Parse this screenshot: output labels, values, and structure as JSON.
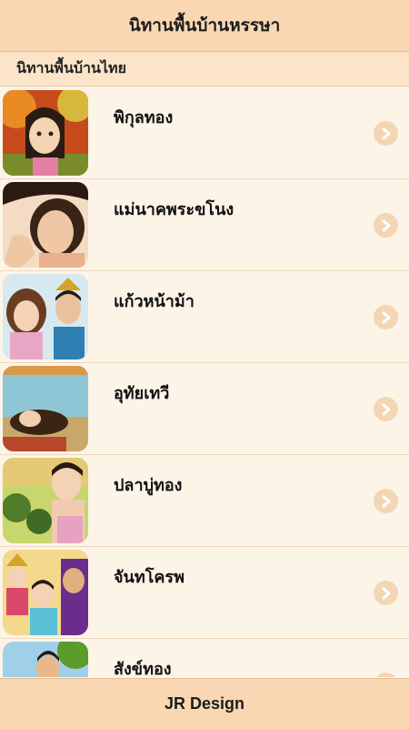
{
  "app": {
    "title": "นิทานพื้นบ้านหรรษา"
  },
  "section": {
    "title": "นิทานพื้นบ้านไทย"
  },
  "stories": [
    {
      "title": "พิกุลทอง"
    },
    {
      "title": "แม่นาคพระขโนง"
    },
    {
      "title": "แก้วหน้าม้า"
    },
    {
      "title": "อุทัยเทวี"
    },
    {
      "title": "ปลาบู่ทอง"
    },
    {
      "title": "จันทโครพ"
    },
    {
      "title": "สังข์ทอง"
    }
  ],
  "footer": {
    "label": "JR Design"
  },
  "colors": {
    "bar": "#f9d7b2",
    "row": "#fdf4e8",
    "chevron": "#f3d6b4"
  }
}
